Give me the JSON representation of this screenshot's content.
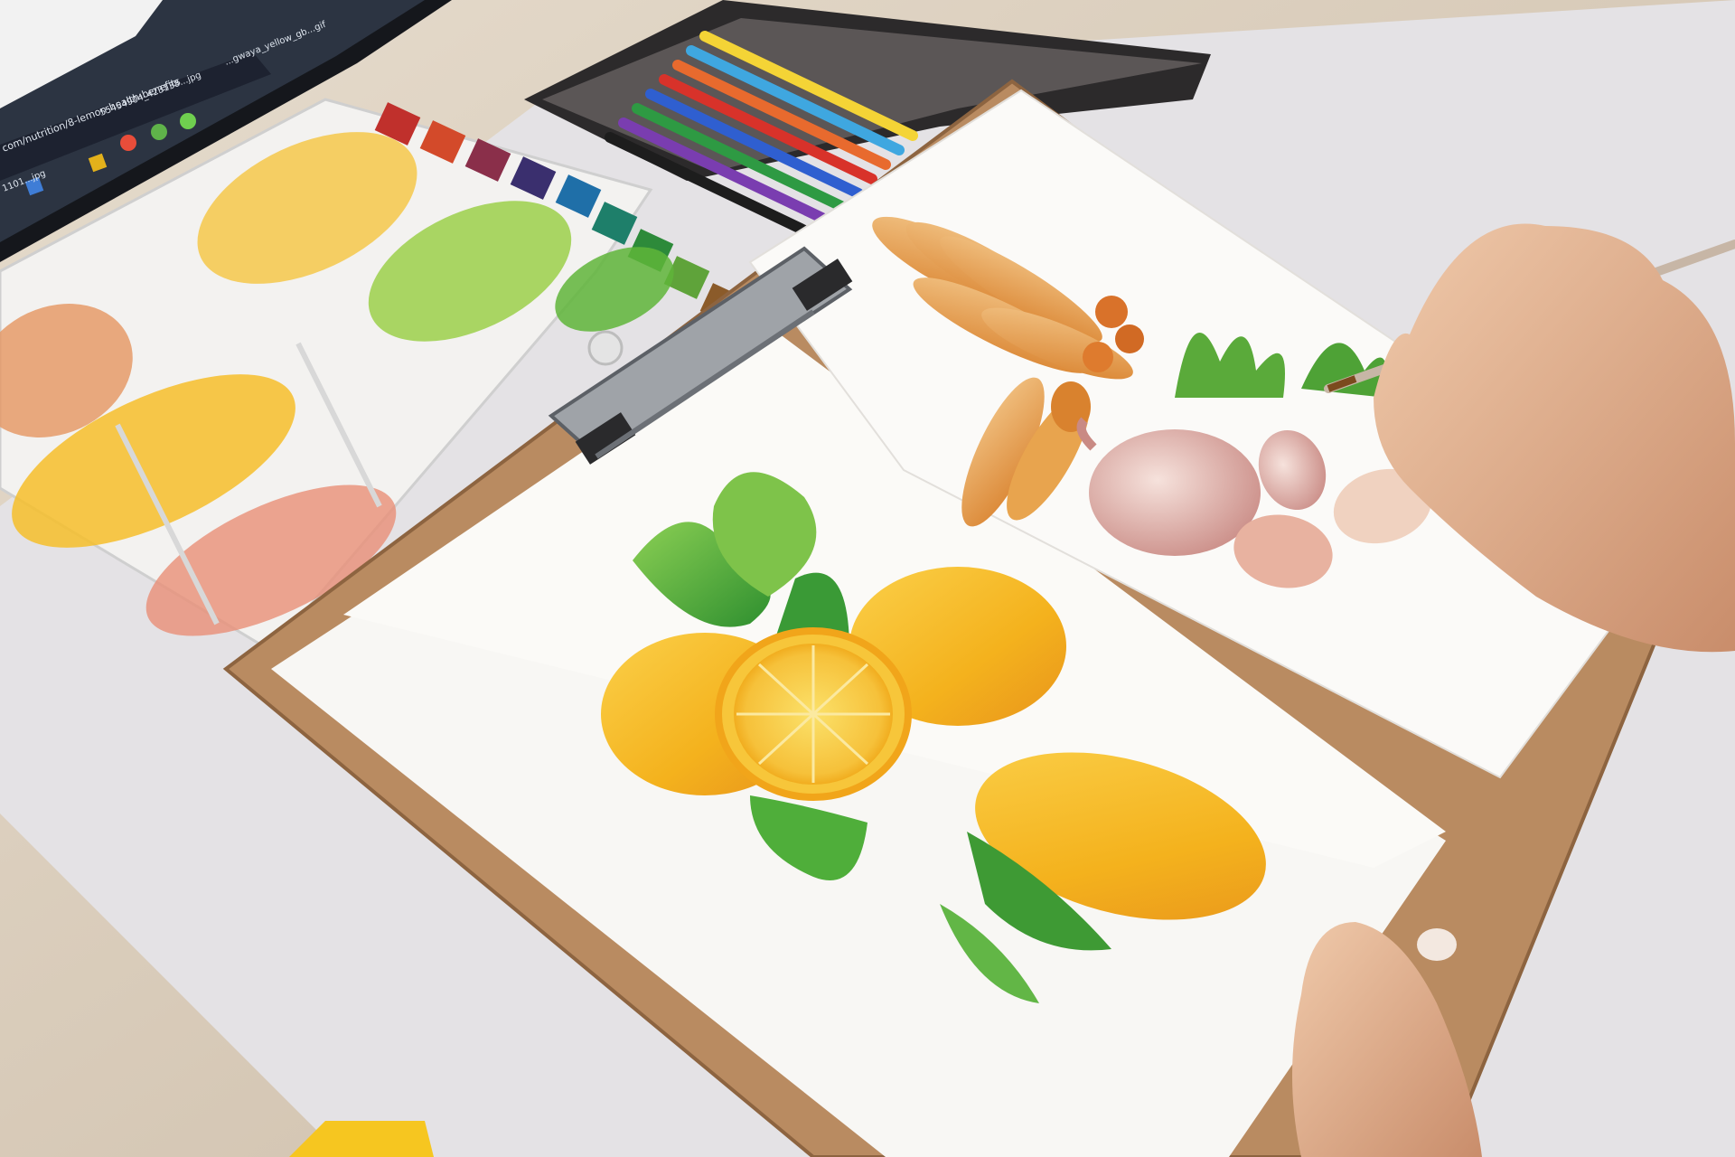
{
  "scene": {
    "subject": "watercolor-painting-on-clipboard",
    "monitor_taskbar": {
      "url_fragment": "com/nutrition/8-lemon-health-benefits",
      "file_tab_1": "55454904_423138...jpg",
      "file_tab_2": "...gwaya_yellow_gb...gif",
      "file_tab_3": "1101...jpg"
    },
    "colors": {
      "desk": "#d9cfc1",
      "table_white": "#e6e4e6",
      "clipboard": "#b98a62",
      "paper": "#faf9f6",
      "lemon": "#f5b622",
      "leaf": "#4aa836",
      "garlic": "#d9a9a3",
      "ginger": "#e59a3c",
      "skin": "#e2b596"
    }
  }
}
